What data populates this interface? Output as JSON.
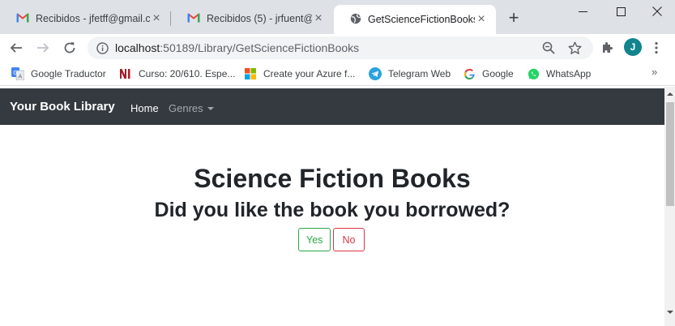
{
  "browser": {
    "tabs": [
      {
        "label": "Recibidos - jfetff@gmail.c",
        "icon": "gmail-icon"
      },
      {
        "label": "Recibidos (5) - jrfuent@gr",
        "icon": "gmail-icon"
      },
      {
        "label": "GetScienceFictionBooks",
        "icon": "globe-icon"
      }
    ],
    "url_host": "localhost",
    "url_rest": ":50189/Library/GetScienceFictionBooks",
    "profile_initial": "J",
    "bookmarks": [
      {
        "label": "Google Traductor",
        "icon": "google-translate-icon"
      },
      {
        "label": "Curso: 20/610. Espe...",
        "icon": "ni-icon"
      },
      {
        "label": "Create your Azure f...",
        "icon": "microsoft-icon"
      },
      {
        "label": "Telegram Web",
        "icon": "telegram-icon"
      },
      {
        "label": "Google",
        "icon": "google-icon"
      },
      {
        "label": "WhatsApp",
        "icon": "whatsapp-icon"
      }
    ]
  },
  "navbar": {
    "brand": "Your Book Library",
    "home": "Home",
    "genres": "Genres"
  },
  "main": {
    "title": "Science Fiction Books",
    "question": "Did you like the book you borrowed?",
    "yes_label": "Yes",
    "no_label": "No"
  },
  "colors": {
    "navbar_bg": "#343a40",
    "yes": "#28a745",
    "no": "#dc3545",
    "avatar": "#12848e"
  }
}
